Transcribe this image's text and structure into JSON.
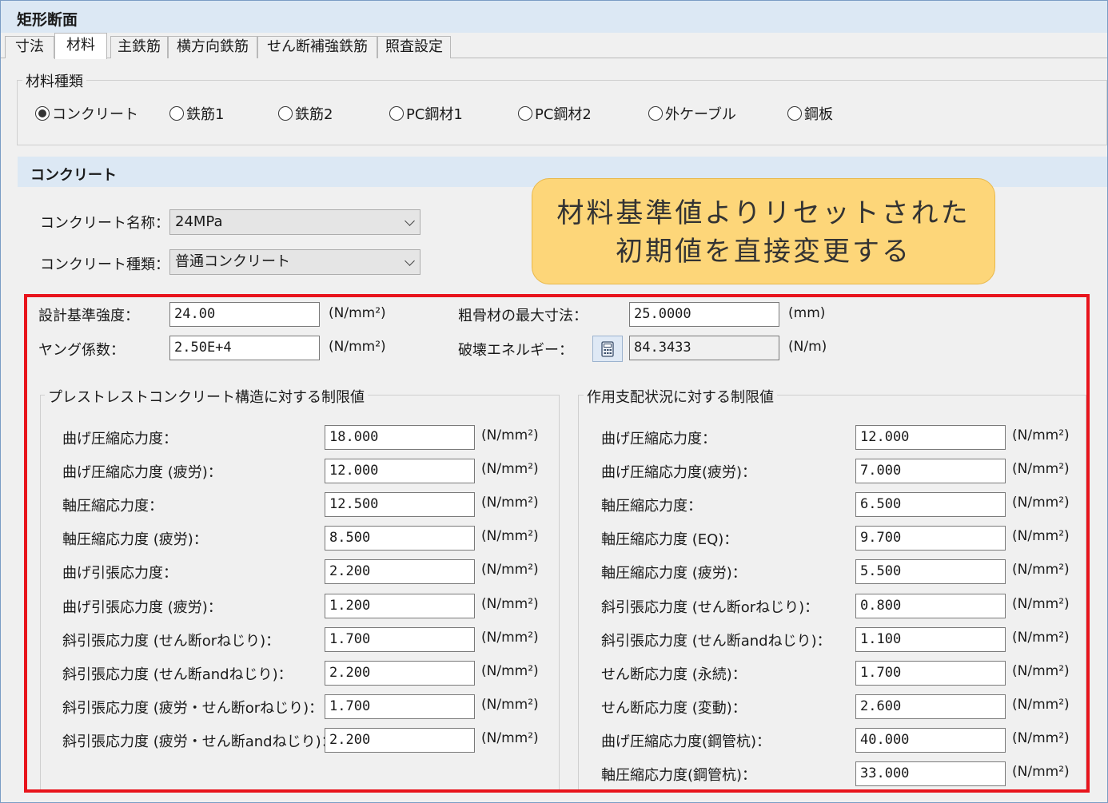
{
  "window": {
    "title": "矩形断面"
  },
  "tabs": [
    "寸法",
    "材料",
    "主鉄筋",
    "横方向鉄筋",
    "せん断補強鉄筋",
    "照査設定"
  ],
  "material_type": {
    "group_title": "材料種類",
    "options": [
      "コンクリート",
      "鉄筋1",
      "鉄筋2",
      "PC鋼材1",
      "PC鋼材2",
      "外ケーブル",
      "鋼板"
    ],
    "selected": "コンクリート"
  },
  "concrete": {
    "header": "コンクリート",
    "name_label": "コンクリート名称：",
    "name_value": "24MPa",
    "kind_label": "コンクリート種類：",
    "kind_value": "普通コンクリート"
  },
  "callout": {
    "line1": "材料基準値よりリセットされた",
    "line2": "初期値を直接変更する"
  },
  "props": {
    "design_strength": {
      "label": "設計基準強度：",
      "value": "24.00",
      "unit": "(N/mm²)"
    },
    "young": {
      "label": "ヤング係数：",
      "value": "2.50E+4",
      "unit": "(N/mm²)"
    },
    "aggregate": {
      "label": "粗骨材の最大寸法：",
      "value": "25.0000",
      "unit": "(mm)"
    },
    "fracture": {
      "label": "破壊エネルギー：",
      "value": "84.3433",
      "unit": "(N/m)"
    }
  },
  "pc_limits": {
    "title": "プレストレストコンクリート構造に対する制限値",
    "rows": [
      {
        "label": "曲げ圧縮応力度：",
        "value": "18.000",
        "unit": "(N/mm²)"
      },
      {
        "label": "曲げ圧縮応力度 (疲労)：",
        "value": "12.000",
        "unit": "(N/mm²)"
      },
      {
        "label": "軸圧縮応力度：",
        "value": "12.500",
        "unit": "(N/mm²)"
      },
      {
        "label": "軸圧縮応力度 (疲労)：",
        "value": "8.500",
        "unit": "(N/mm²)"
      },
      {
        "label": "曲げ引張応力度：",
        "value": "2.200",
        "unit": "(N/mm²)"
      },
      {
        "label": "曲げ引張応力度 (疲労)：",
        "value": "1.200",
        "unit": "(N/mm²)"
      },
      {
        "label": "斜引張応力度 (せん断orねじり)：",
        "value": "1.700",
        "unit": "(N/mm²)"
      },
      {
        "label": "斜引張応力度 (せん断andねじり)：",
        "value": "2.200",
        "unit": "(N/mm²)"
      },
      {
        "label": "斜引張応力度 (疲労・せん断orねじり)：",
        "value": "1.700",
        "unit": "(N/mm²)"
      },
      {
        "label": "斜引張応力度 (疲労・せん断andねじり)：",
        "value": "2.200",
        "unit": "(N/mm²)"
      }
    ]
  },
  "action_limits": {
    "title": "作用支配状況に対する制限値",
    "rows": [
      {
        "label": "曲げ圧縮応力度：",
        "value": "12.000",
        "unit": "(N/mm²)"
      },
      {
        "label": "曲げ圧縮応力度(疲労)：",
        "value": "7.000",
        "unit": "(N/mm²)"
      },
      {
        "label": "軸圧縮応力度：",
        "value": "6.500",
        "unit": "(N/mm²)"
      },
      {
        "label": "軸圧縮応力度 (EQ)：",
        "value": "9.700",
        "unit": "(N/mm²)"
      },
      {
        "label": "軸圧縮応力度 (疲労)：",
        "value": "5.500",
        "unit": "(N/mm²)"
      },
      {
        "label": "斜引張応力度 (せん断orねじり)：",
        "value": "0.800",
        "unit": "(N/mm²)"
      },
      {
        "label": "斜引張応力度 (せん断andねじり)：",
        "value": "1.100",
        "unit": "(N/mm²)"
      },
      {
        "label": "せん断応力度 (永続)：",
        "value": "1.700",
        "unit": "(N/mm²)"
      },
      {
        "label": "せん断応力度 (変動)：",
        "value": "2.600",
        "unit": "(N/mm²)"
      },
      {
        "label": "曲げ圧縮応力度(鋼管杭)：",
        "value": "40.000",
        "unit": "(N/mm²)"
      },
      {
        "label": "軸圧縮応力度(鋼管杭)：",
        "value": "33.000",
        "unit": "(N/mm²)"
      }
    ]
  },
  "colors": {
    "highlight_border": "#e8141c",
    "callout_fill": "#fdd679",
    "header_fill": "#dce8f4"
  }
}
